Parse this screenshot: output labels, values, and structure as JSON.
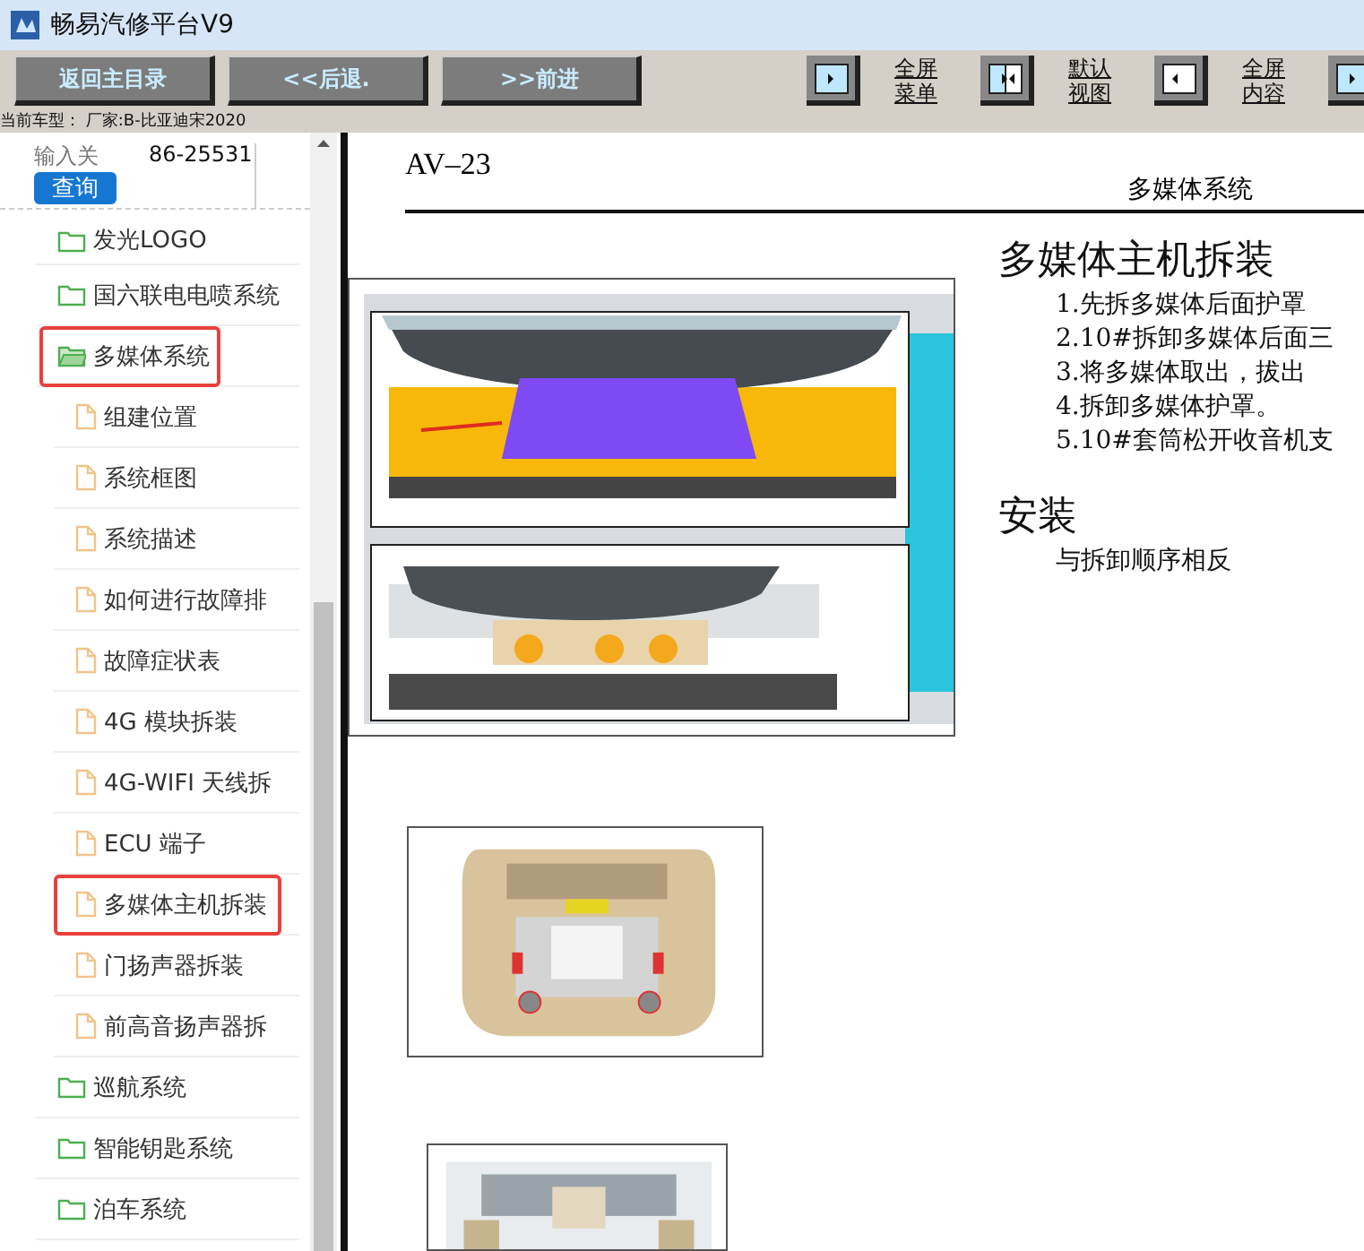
{
  "window": {
    "title": "畅易汽修平台V9"
  },
  "toolbar": {
    "buttons": [
      "返回主目录",
      "<<后退.",
      ">>前进"
    ],
    "view_buttons": [
      {
        "kind": "menu",
        "label": [
          "全屏",
          "菜单"
        ]
      },
      {
        "kind": "default",
        "label": [
          "默认",
          "视图"
        ]
      },
      {
        "kind": "content",
        "label": [
          "全屏",
          "内容"
        ]
      },
      {
        "kind": "menu"
      }
    ]
  },
  "current_model": "当前车型： 厂家:B-比亚迪宋2020",
  "search": {
    "label": "输入关",
    "value": "86-25531",
    "button": "查询"
  },
  "tree": [
    {
      "label": "发光LOGO",
      "expanded": false,
      "highlighted": false
    },
    {
      "label": "国六联电电喷系统",
      "expanded": false,
      "highlighted": false
    },
    {
      "label": "多媒体系统",
      "expanded": true,
      "highlighted": true,
      "children": [
        {
          "label": "组建位置",
          "highlighted": false
        },
        {
          "label": "系统框图",
          "highlighted": false
        },
        {
          "label": "系统描述",
          "highlighted": false
        },
        {
          "label": "如何进行故障排",
          "highlighted": false
        },
        {
          "label": "故障症状表",
          "highlighted": false
        },
        {
          "label": "4G 模块拆装",
          "highlighted": false
        },
        {
          "label": "4G-WIFI 天线拆",
          "highlighted": false
        },
        {
          "label": "ECU 端子",
          "highlighted": false
        },
        {
          "label": "多媒体主机拆装",
          "highlighted": true
        },
        {
          "label": "门扬声器拆装",
          "highlighted": false
        },
        {
          "label": "前高音扬声器拆",
          "highlighted": false
        }
      ]
    },
    {
      "label": "巡航系统",
      "expanded": false,
      "highlighted": false
    },
    {
      "label": "智能钥匙系统",
      "expanded": false,
      "highlighted": false
    },
    {
      "label": "泊车系统",
      "expanded": false,
      "highlighted": false
    }
  ],
  "document": {
    "page": "AV–23",
    "section": "多媒体系统",
    "title": "多媒体主机拆装",
    "steps": [
      "1.先拆多媒体后面护罩",
      "2.10#拆卸多媒体后面三",
      "3.将多媒体取出，拔出",
      "4.拆卸多媒体护罩。",
      "5.10#套筒松开收音机支"
    ],
    "install_title": "安装",
    "install_text": "与拆卸顺序相反",
    "figures": [
      {
        "kind": "picture"
      },
      {
        "kind": "picture"
      },
      {
        "kind": "picture"
      }
    ]
  }
}
